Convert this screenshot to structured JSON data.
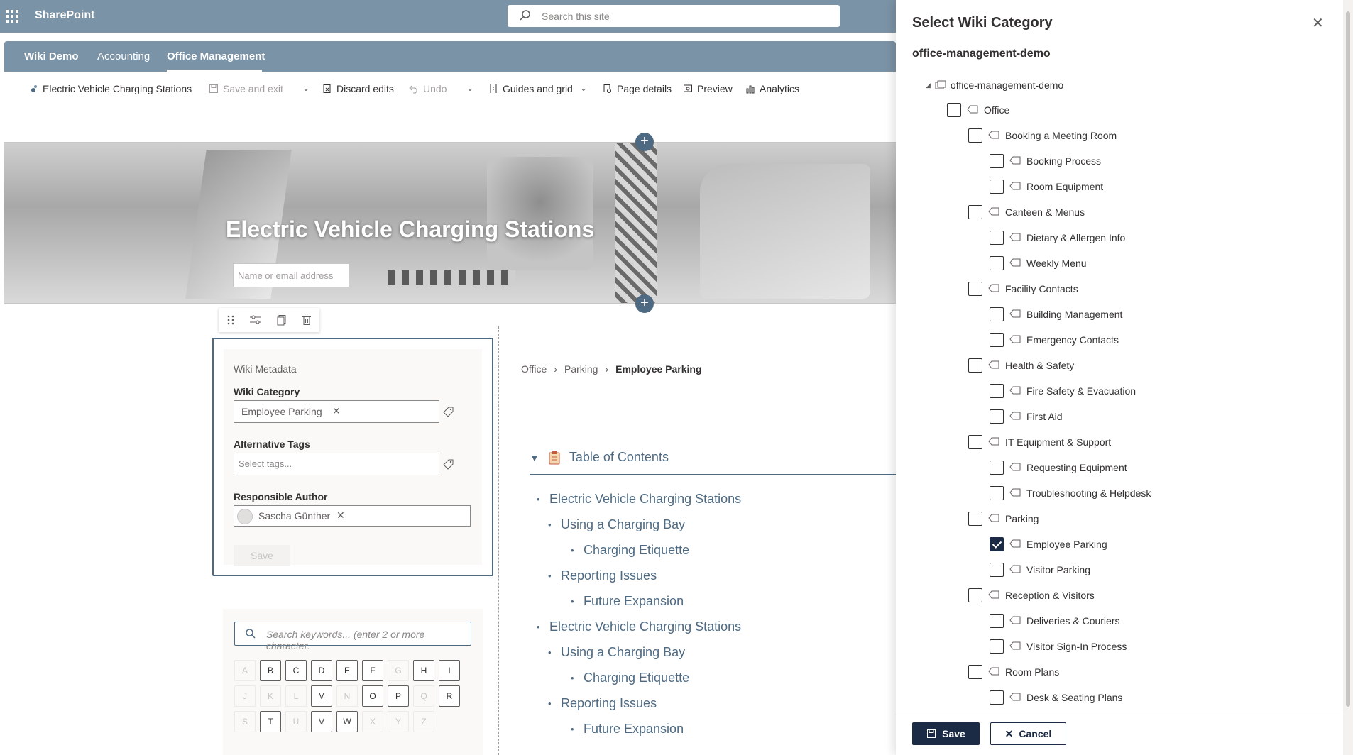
{
  "app": {
    "brand": "SharePoint",
    "search_placeholder": "Search this site"
  },
  "sitenav": {
    "items": [
      {
        "label": "Wiki Demo"
      },
      {
        "label": "Accounting"
      },
      {
        "label": "Office Management"
      }
    ]
  },
  "commandbar": {
    "page_name": "Electric Vehicle Charging Stations",
    "save_exit": "Save and exit",
    "discard": "Discard edits",
    "undo": "Undo",
    "guides": "Guides and grid",
    "page_details": "Page details",
    "preview": "Preview",
    "analytics": "Analytics"
  },
  "hero": {
    "title": "Electric Vehicle Charging Stations",
    "author_placeholder": "Name or email address"
  },
  "metadata": {
    "heading": "Wiki Metadata",
    "category_label": "Wiki Category",
    "category_value": "Employee Parking",
    "tags_label": "Alternative Tags",
    "tags_placeholder": "Select tags...",
    "author_label": "Responsible Author",
    "author_value": "Sascha Günther",
    "save": "Save"
  },
  "keywords": {
    "placeholder": "Search keywords... (enter 2 or more character.",
    "letters": [
      {
        "l": "A",
        "on": false
      },
      {
        "l": "B",
        "on": true
      },
      {
        "l": "C",
        "on": true
      },
      {
        "l": "D",
        "on": true
      },
      {
        "l": "E",
        "on": true
      },
      {
        "l": "F",
        "on": true
      },
      {
        "l": "G",
        "on": false
      },
      {
        "l": "H",
        "on": true
      },
      {
        "l": "I",
        "on": true
      },
      {
        "l": "J",
        "on": false
      },
      {
        "l": "K",
        "on": false
      },
      {
        "l": "L",
        "on": false
      },
      {
        "l": "M",
        "on": true
      },
      {
        "l": "N",
        "on": false
      },
      {
        "l": "O",
        "on": true
      },
      {
        "l": "P",
        "on": true
      },
      {
        "l": "Q",
        "on": false
      },
      {
        "l": "R",
        "on": true
      },
      {
        "l": "S",
        "on": false
      },
      {
        "l": "T",
        "on": true
      },
      {
        "l": "U",
        "on": false
      },
      {
        "l": "V",
        "on": true
      },
      {
        "l": "W",
        "on": true
      },
      {
        "l": "X",
        "on": false
      },
      {
        "l": "Y",
        "on": false
      },
      {
        "l": "Z",
        "on": false
      }
    ]
  },
  "breadcrumb": [
    "Office",
    "Parking",
    "Employee Parking"
  ],
  "toc": {
    "title": "Table of Contents",
    "items": [
      {
        "text": "Electric Vehicle Charging Stations",
        "level": 1
      },
      {
        "text": "Using a Charging Bay",
        "level": 2
      },
      {
        "text": "Charging Etiquette",
        "level": 3
      },
      {
        "text": "Reporting Issues",
        "level": 2
      },
      {
        "text": "Future Expansion",
        "level": 3
      },
      {
        "text": "Electric Vehicle Charging Stations",
        "level": 1
      },
      {
        "text": "Using a Charging Bay",
        "level": 2
      },
      {
        "text": "Charging Etiquette",
        "level": 3
      },
      {
        "text": "Reporting Issues",
        "level": 2
      },
      {
        "text": "Future Expansion",
        "level": 3
      }
    ]
  },
  "panel": {
    "title": "Select Wiki Category",
    "subtitle": "office-management-demo",
    "root": "office-management-demo",
    "nodes": [
      {
        "label": "Office",
        "level": 0,
        "checked": false
      },
      {
        "label": "Booking a Meeting Room",
        "level": 1,
        "checked": false
      },
      {
        "label": "Booking Process",
        "level": 2,
        "checked": false
      },
      {
        "label": "Room Equipment",
        "level": 2,
        "checked": false
      },
      {
        "label": "Canteen & Menus",
        "level": 1,
        "checked": false
      },
      {
        "label": "Dietary & Allergen Info",
        "level": 2,
        "checked": false
      },
      {
        "label": "Weekly Menu",
        "level": 2,
        "checked": false
      },
      {
        "label": "Facility Contacts",
        "level": 1,
        "checked": false
      },
      {
        "label": "Building Management",
        "level": 2,
        "checked": false
      },
      {
        "label": "Emergency Contacts",
        "level": 2,
        "checked": false
      },
      {
        "label": "Health & Safety",
        "level": 1,
        "checked": false
      },
      {
        "label": "Fire Safety & Evacuation",
        "level": 2,
        "checked": false
      },
      {
        "label": "First Aid",
        "level": 2,
        "checked": false
      },
      {
        "label": "IT Equipment & Support",
        "level": 1,
        "checked": false
      },
      {
        "label": "Requesting Equipment",
        "level": 2,
        "checked": false
      },
      {
        "label": "Troubleshooting & Helpdesk",
        "level": 2,
        "checked": false
      },
      {
        "label": "Parking",
        "level": 1,
        "checked": false
      },
      {
        "label": "Employee Parking",
        "level": 2,
        "checked": true
      },
      {
        "label": "Visitor Parking",
        "level": 2,
        "checked": false
      },
      {
        "label": "Reception & Visitors",
        "level": 1,
        "checked": false
      },
      {
        "label": "Deliveries & Couriers",
        "level": 2,
        "checked": false
      },
      {
        "label": "Visitor Sign-In Process",
        "level": 2,
        "checked": false
      },
      {
        "label": "Room Plans",
        "level": 1,
        "checked": false
      },
      {
        "label": "Desk & Seating Plans",
        "level": 2,
        "checked": false
      }
    ],
    "save": "Save",
    "cancel": "Cancel"
  },
  "colors": {
    "suite_bar": "#7b93a6",
    "accent": "#4e6a82",
    "primary_button": "#1b2b45"
  }
}
